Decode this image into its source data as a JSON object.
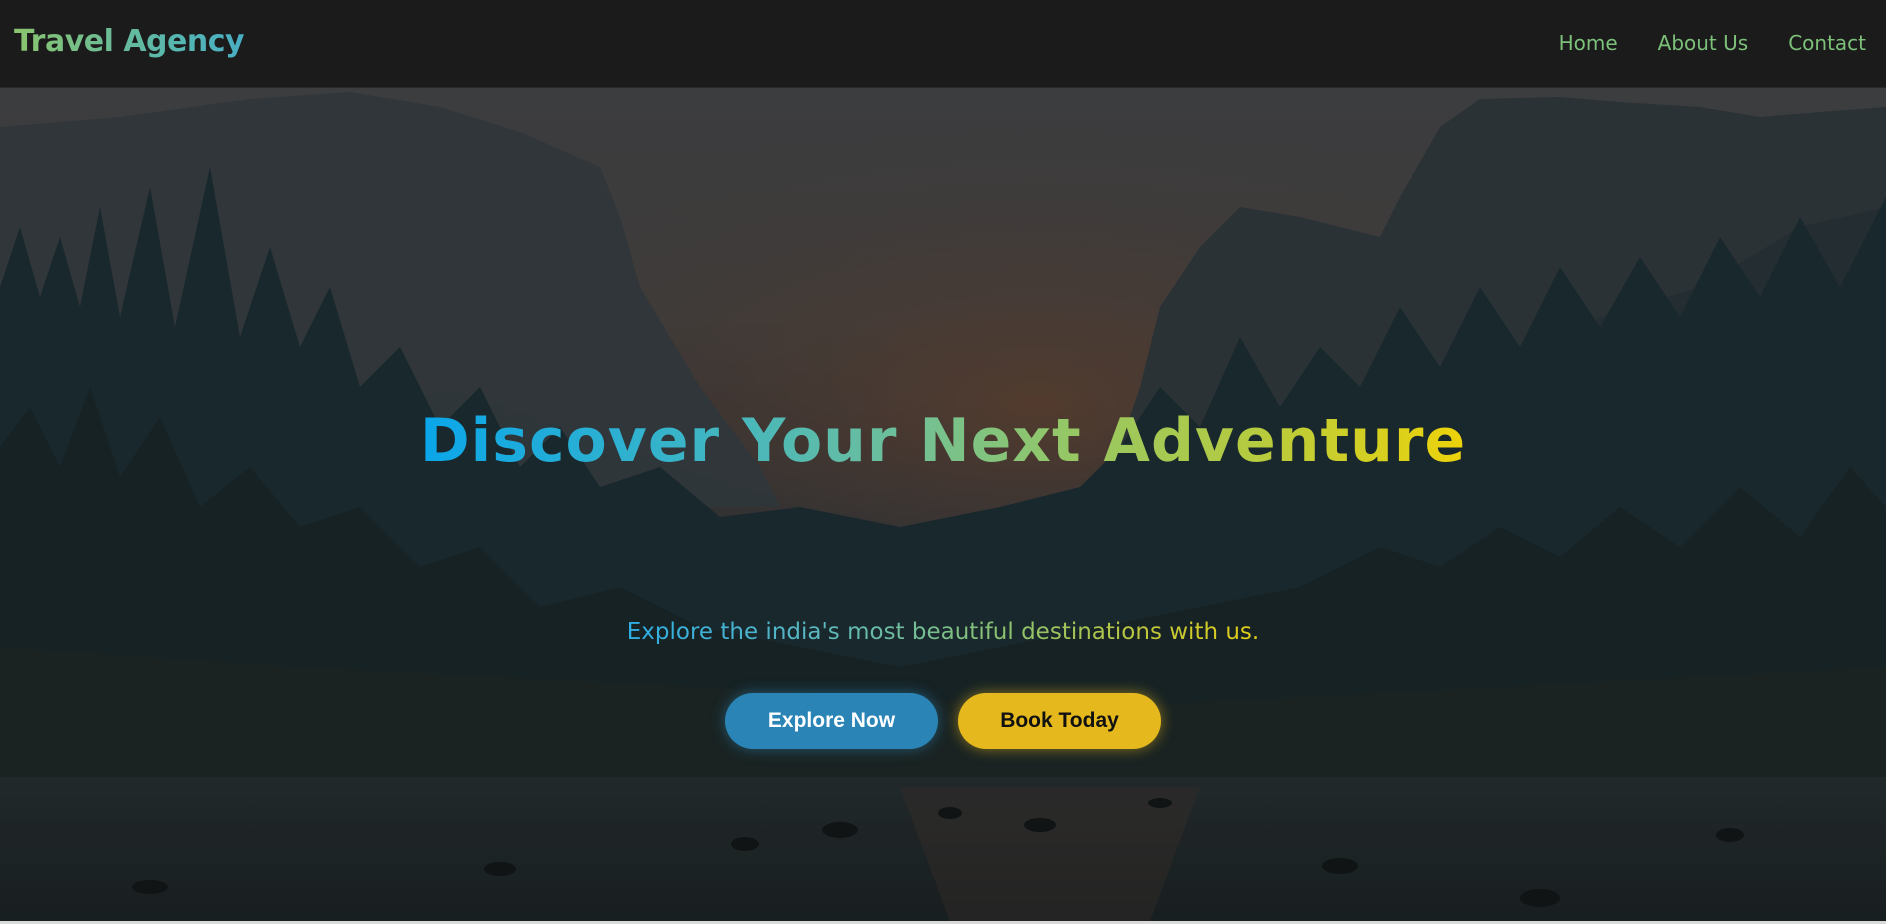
{
  "navbar": {
    "brand": "Travel Agency",
    "links": [
      "Home",
      "About Us",
      "Contact"
    ]
  },
  "hero": {
    "title": "Discover Your Next Adventure",
    "subtitle": "Explore the india's most beautiful destinations with us.",
    "buttons": {
      "explore_label": "Explore Now",
      "book_label": "Book Today"
    }
  },
  "colors": {
    "navbar_bg": "#1b1b1b",
    "nav_link": "#7cc07a",
    "explore_button": "#2a85b6",
    "book_button": "#e5b81d",
    "title_gradient": [
      "#0aa6ea",
      "#6cbf9c",
      "#b6cb3f",
      "#eed30a"
    ]
  }
}
